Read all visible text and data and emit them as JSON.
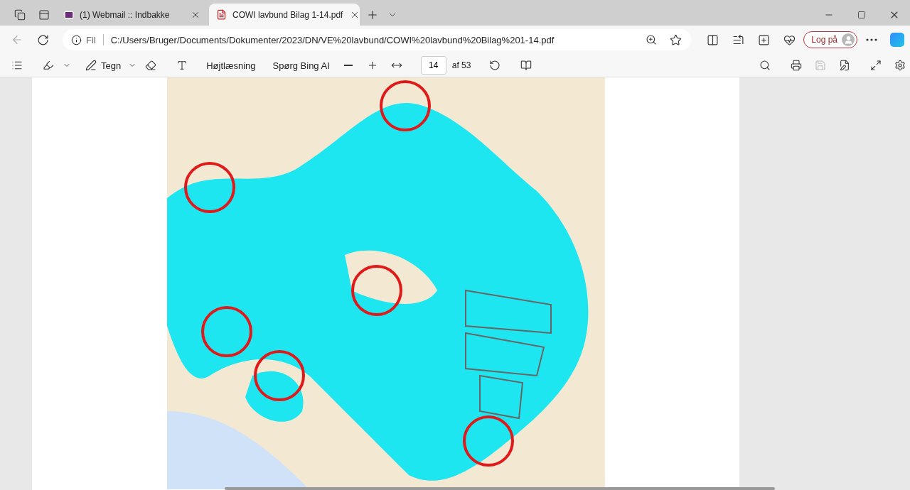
{
  "tabs": [
    {
      "title": "(1) Webmail :: Indbakke",
      "kind": "mail",
      "selected": false
    },
    {
      "title": "COWI lavbund Bilag 1-14.pdf",
      "kind": "pdf",
      "selected": true
    }
  ],
  "address": {
    "scheme": "Fil",
    "url": "C:/Users/Bruger/Documents/Dokumenter/2023/DN/VE%20lavbund/COWI%20lavbund%20Bilag%201-14.pdf"
  },
  "profile": {
    "label": "Log på"
  },
  "pdf_toolbar": {
    "draw_label": "Tegn",
    "read_aloud": "Højtlæsning",
    "ask": "Spørg Bing AI",
    "page": "14",
    "page_count": "af 53"
  }
}
